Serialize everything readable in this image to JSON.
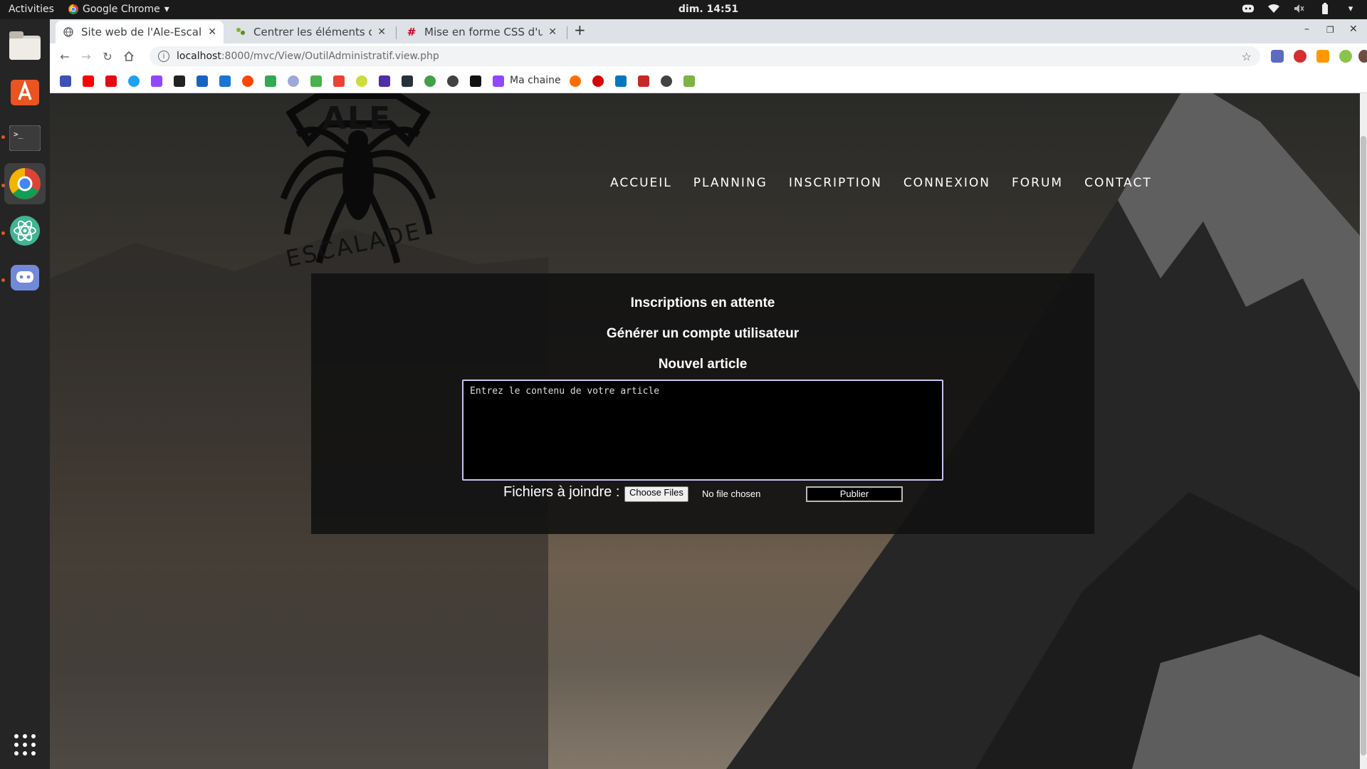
{
  "topbar": {
    "activities": "Activities",
    "app_name": "Google Chrome",
    "clock": "dim. 14:51"
  },
  "dock": {
    "items": [
      "files-icon",
      "ubuntu-software-icon",
      "terminal-icon",
      "chrome-icon",
      "atom-icon",
      "discord-icon",
      "show-apps-icon"
    ]
  },
  "browser": {
    "tabs": [
      {
        "title": "Site web de l'Ale-Escalade",
        "active": true
      },
      {
        "title": "Centrer les éléments ou u",
        "active": false
      },
      {
        "title": "Mise en forme CSS d'un fo",
        "active": false
      }
    ],
    "url_host": "localhost",
    "url_path": ":8000/mvc/View/OutilAdministratif.view.php",
    "bookmark_label": "Ma chaine"
  },
  "site": {
    "logo_top": "ALE",
    "logo_bottom": "ESCALADE",
    "nav": [
      "ACCUEIL",
      "PLANNING",
      "INSCRIPTION",
      "CONNEXION",
      "FORUM",
      "CONTACT"
    ]
  },
  "admin": {
    "pending": "Inscriptions en attente",
    "generate": "Générer un compte utilisateur",
    "new_article": "Nouvel article",
    "article_placeholder": "Entrez le contenu de votre article",
    "files_label": "Fichiers à joindre :",
    "choose_files": "Choose Files",
    "no_file": "No file chosen",
    "publish": "Publier"
  },
  "colors": {
    "accent": "#e95420",
    "textarea_border": "#c9c3f1",
    "panel_bg": "#121212"
  }
}
